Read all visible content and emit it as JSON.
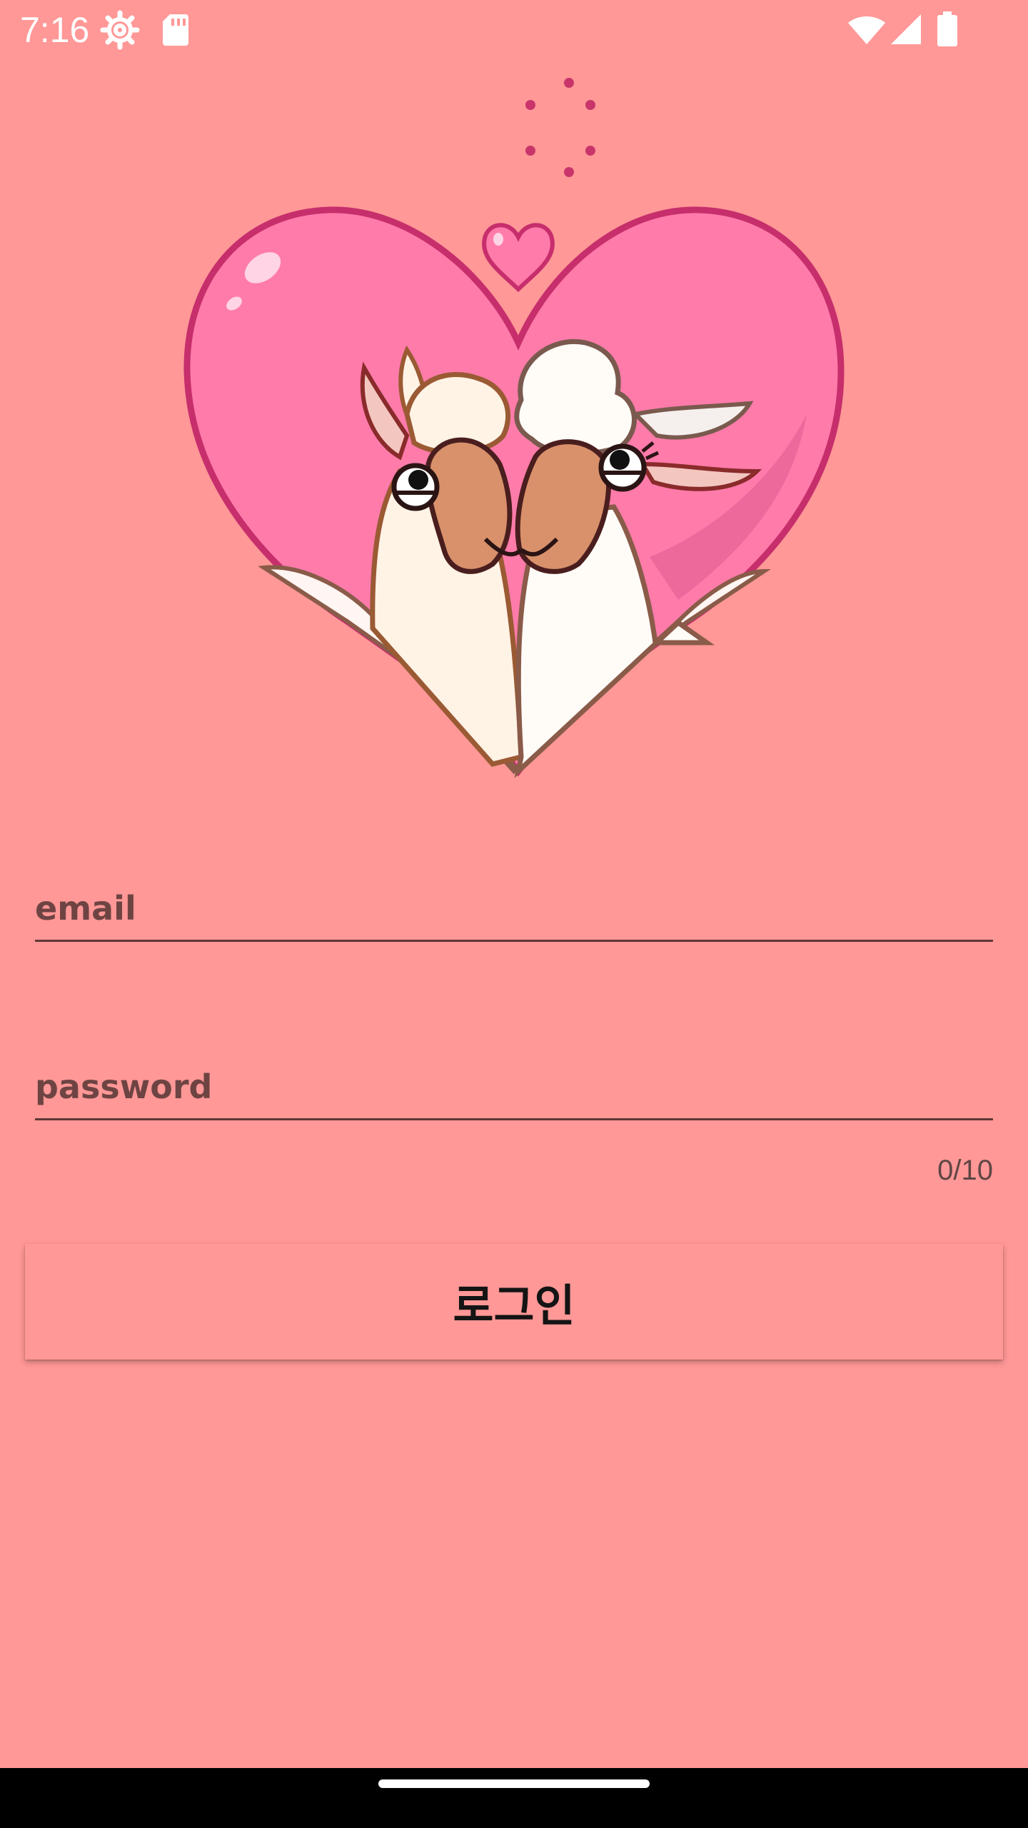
{
  "status_bar": {
    "time": "7:16",
    "icons": [
      "settings-gear-icon",
      "sd-card-icon",
      "wifi-icon",
      "cell-signal-icon",
      "battery-icon"
    ]
  },
  "loader": {
    "icon": "loading-spinner-icon",
    "color": "#C9356B"
  },
  "illustration": {
    "description_icon": "heart-couple-llama-illustration",
    "colors": {
      "heart_fill": "#FF7BAA",
      "heart_stroke": "#C72E6C"
    }
  },
  "form": {
    "email": {
      "placeholder": "email",
      "value": ""
    },
    "password": {
      "placeholder": "password",
      "value": "",
      "counter": "0/10"
    },
    "login_button": {
      "label": "로그인"
    }
  },
  "colors": {
    "background": "#FF9897",
    "field_line": "#5E3836",
    "button_text": "#141414"
  }
}
